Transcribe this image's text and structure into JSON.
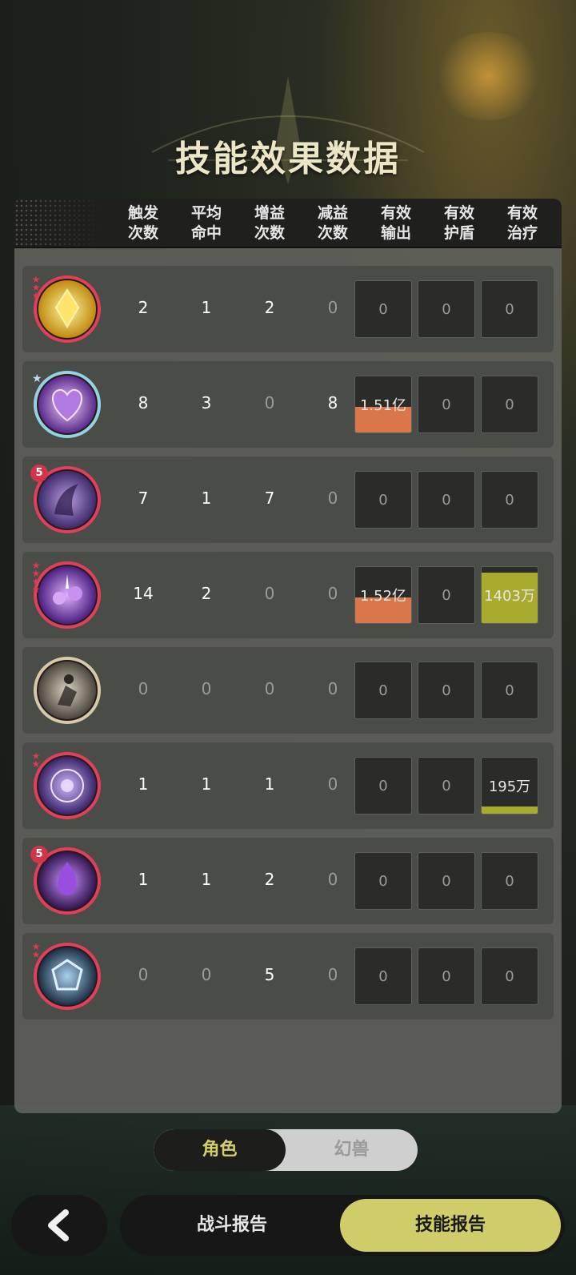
{
  "title": "技能效果数据",
  "columns": [
    "触发\n次数",
    "平均\n命中",
    "增益\n次数",
    "减益\n次数",
    "有效\n输出",
    "有效\n护盾",
    "有效\n治疗"
  ],
  "colors": {
    "output_fill": "#d9774a",
    "heal_fill": "#a9ab2e"
  },
  "rows": [
    {
      "icon": "golden-crystal-icon",
      "frame": "red",
      "badge": "stars3",
      "trigger": "2",
      "avg_hit": "1",
      "buff": "2",
      "debuff": "0",
      "output": {
        "label": "0",
        "fill": 0
      },
      "shield": {
        "label": "0",
        "fill": 0
      },
      "heal": {
        "label": "0",
        "fill": 0
      }
    },
    {
      "icon": "purple-heart-icon",
      "frame": "cyan",
      "badge": "star-blue",
      "trigger": "8",
      "avg_hit": "3",
      "buff": "0",
      "debuff": "8",
      "output": {
        "label": "1.51亿",
        "fill": 0.45
      },
      "shield": {
        "label": "0",
        "fill": 0
      },
      "heal": {
        "label": "0",
        "fill": 0
      }
    },
    {
      "icon": "purple-wings-icon",
      "frame": "red",
      "badge": "5",
      "trigger": "7",
      "avg_hit": "1",
      "buff": "7",
      "debuff": "0",
      "output": {
        "label": "0",
        "fill": 0
      },
      "shield": {
        "label": "0",
        "fill": 0
      },
      "heal": {
        "label": "0",
        "fill": 0
      }
    },
    {
      "icon": "purple-roses-icon",
      "frame": "red",
      "badge": "stars4",
      "trigger": "14",
      "avg_hit": "2",
      "buff": "0",
      "debuff": "0",
      "output": {
        "label": "1.52亿",
        "fill": 0.45
      },
      "shield": {
        "label": "0",
        "fill": 0
      },
      "heal": {
        "label": "1403万",
        "fill": 0.88
      }
    },
    {
      "icon": "silver-figure-icon",
      "frame": "gold",
      "badge": "",
      "trigger": "0",
      "avg_hit": "0",
      "buff": "0",
      "debuff": "0",
      "output": {
        "label": "0",
        "fill": 0
      },
      "shield": {
        "label": "0",
        "fill": 0
      },
      "heal": {
        "label": "0",
        "fill": 0
      }
    },
    {
      "icon": "violet-orb-icon",
      "frame": "red",
      "badge": "stars2",
      "trigger": "1",
      "avg_hit": "1",
      "buff": "1",
      "debuff": "0",
      "output": {
        "label": "0",
        "fill": 0
      },
      "shield": {
        "label": "0",
        "fill": 0
      },
      "heal": {
        "label": "195万",
        "fill": 0.12
      }
    },
    {
      "icon": "purple-flame-icon",
      "frame": "red",
      "badge": "5",
      "trigger": "1",
      "avg_hit": "1",
      "buff": "2",
      "debuff": "0",
      "output": {
        "label": "0",
        "fill": 0
      },
      "shield": {
        "label": "0",
        "fill": 0
      },
      "heal": {
        "label": "0",
        "fill": 0
      }
    },
    {
      "icon": "blue-crest-icon",
      "frame": "red",
      "badge": "stars2",
      "trigger": "0",
      "avg_hit": "0",
      "buff": "5",
      "debuff": "0",
      "output": {
        "label": "0",
        "fill": 0
      },
      "shield": {
        "label": "0",
        "fill": 0
      },
      "heal": {
        "label": "0",
        "fill": 0
      }
    }
  ],
  "toggle": {
    "character": "角色",
    "beast": "幻兽"
  },
  "tabs": {
    "battle_report": "战斗报告",
    "skill_report": "技能报告"
  },
  "back_icon": "chevron-left-icon"
}
